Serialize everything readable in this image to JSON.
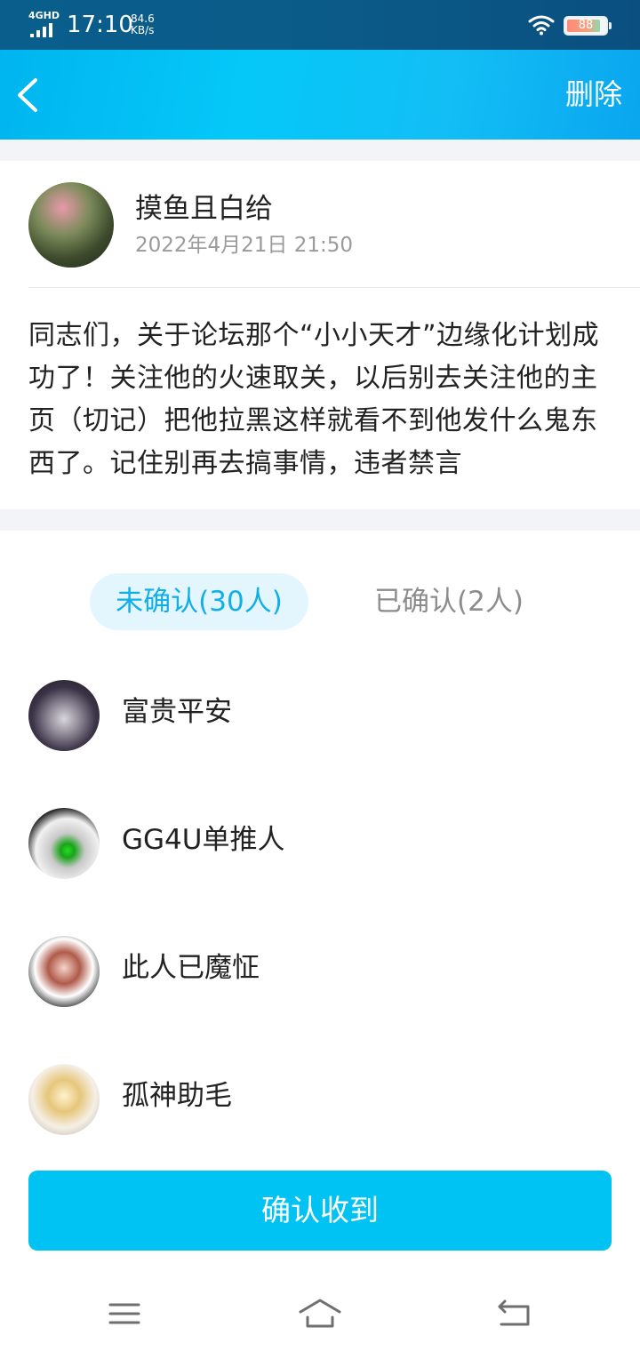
{
  "status_bar": {
    "network": "4GHD",
    "time": "17:10",
    "speed_value": "84.6",
    "speed_unit": "KB/s",
    "battery_level": "88"
  },
  "header": {
    "back_icon": "chevron-left-icon",
    "delete_label": "删除"
  },
  "post": {
    "author_name": "摸鱼且白给",
    "date": "2022年4月21日 21:50",
    "body": "同志们，关于论坛那个“小小天才”边缘化计划成功了！关注他的火速取关，以后别去关注他的主页（切记）把他拉黑这样就看不到他发什么鬼东西了。记住别再去搞事情，违者禁言"
  },
  "tabs": {
    "unconfirmed": "未确认(30人)",
    "confirmed": "已确认(2人)",
    "active": "unconfirmed"
  },
  "members": [
    {
      "name": "富贵平安"
    },
    {
      "name": "GG4U单推人"
    },
    {
      "name": "此人已魔怔"
    },
    {
      "name": "孤神助毛"
    }
  ],
  "confirm_button": "确认收到",
  "nav_bar": {
    "menu_icon": "menu-icon",
    "home_icon": "home-icon",
    "back_icon": "back-arrow-icon"
  },
  "colors": {
    "accent": "#00c3f4",
    "tab_active_bg": "#e3f6fd",
    "tab_active_text": "#12aee8"
  }
}
